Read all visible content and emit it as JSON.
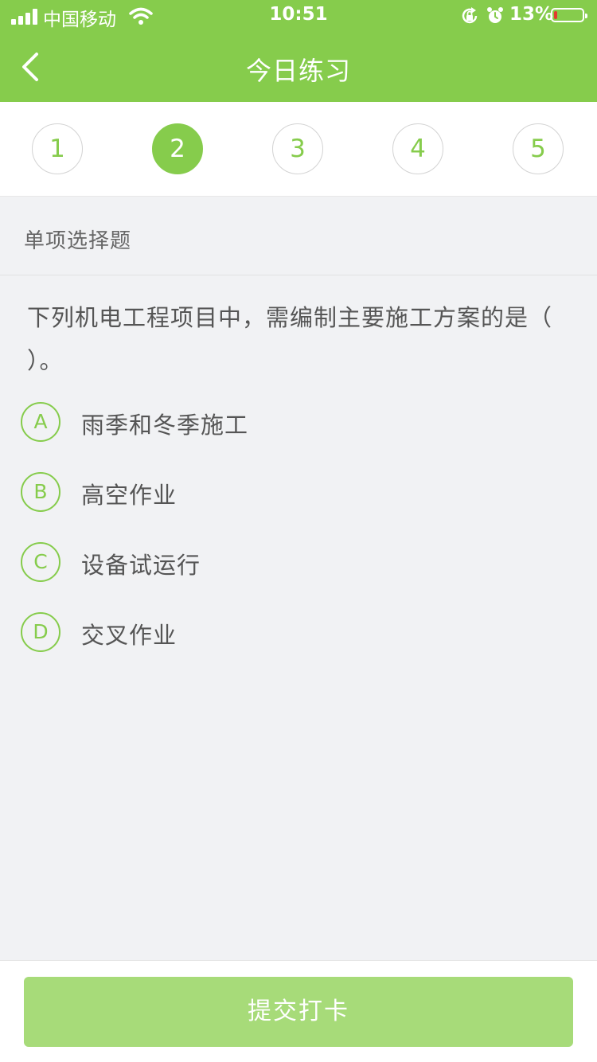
{
  "status_bar": {
    "carrier": "中国移动",
    "time": "10:51",
    "battery_percent": "13%",
    "battery_level": 0.13,
    "battery_color": "#e33b2f"
  },
  "header": {
    "title": "今日练习",
    "back_icon": "chevron-left-icon",
    "background_color": "#86cc4c"
  },
  "question_tabs": [
    {
      "label": "1",
      "active": false
    },
    {
      "label": "2",
      "active": true
    },
    {
      "label": "3",
      "active": false
    },
    {
      "label": "4",
      "active": false
    },
    {
      "label": "5",
      "active": false
    }
  ],
  "section": {
    "type_label": "单项选择题"
  },
  "question": {
    "text": "下列机电工程项目中，需编制主要施工方案的是（    ）。"
  },
  "options": [
    {
      "letter": "A",
      "text": "雨季和冬季施工"
    },
    {
      "letter": "B",
      "text": "高空作业"
    },
    {
      "letter": "C",
      "text": "设备试运行"
    },
    {
      "letter": "D",
      "text": "交叉作业"
    }
  ],
  "footer": {
    "submit_label": "提交打卡",
    "submit_color": "#a7db79"
  }
}
